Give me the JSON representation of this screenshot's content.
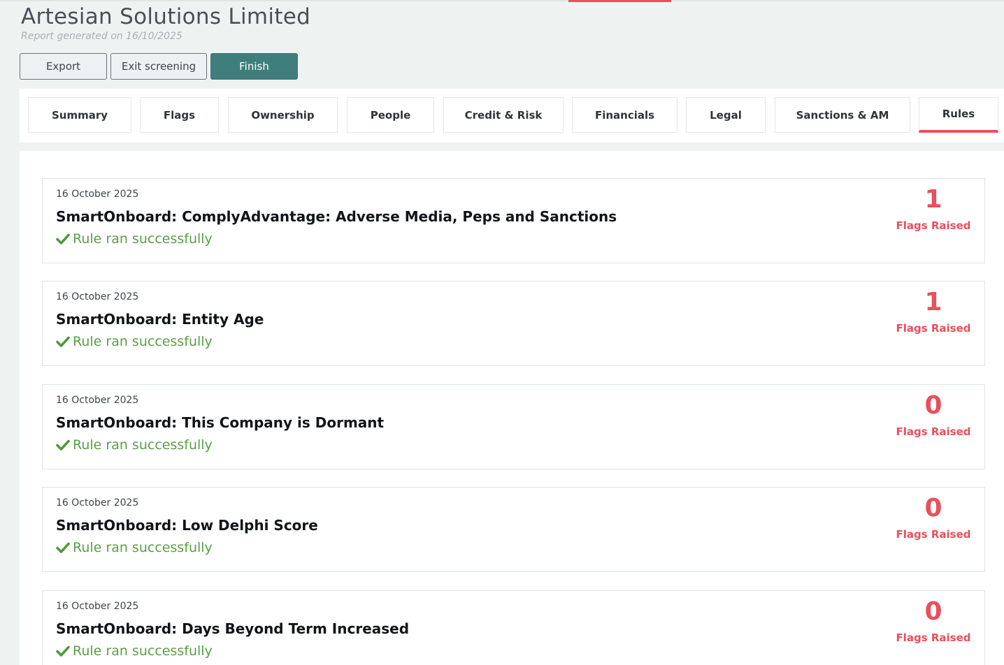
{
  "header": {
    "company_name": "Artesian Solutions Limited",
    "report_generated": "Report generated on 16/10/2025"
  },
  "actions": {
    "export_label": "Export",
    "exit_label": "Exit screening",
    "finish_label": "Finish"
  },
  "tabs": [
    {
      "label": "Summary",
      "active": false
    },
    {
      "label": "Flags",
      "active": false
    },
    {
      "label": "Ownership",
      "active": false
    },
    {
      "label": "People",
      "active": false
    },
    {
      "label": "Credit & Risk",
      "active": false
    },
    {
      "label": "Financials",
      "active": false
    },
    {
      "label": "Legal",
      "active": false
    },
    {
      "label": "Sanctions & AM",
      "active": false
    },
    {
      "label": "Rules",
      "active": true
    }
  ],
  "rules": [
    {
      "date": "16 October 2025",
      "title": "SmartOnboard: ComplyAdvantage: Adverse Media, Peps and Sanctions",
      "status": "Rule ran successfully",
      "flags_count": "1",
      "flags_label": "Flags Raised"
    },
    {
      "date": "16 October 2025",
      "title": "SmartOnboard: Entity Age",
      "status": "Rule ran successfully",
      "flags_count": "1",
      "flags_label": "Flags Raised"
    },
    {
      "date": "16 October 2025",
      "title": "SmartOnboard: This Company is Dormant",
      "status": "Rule ran successfully",
      "flags_count": "0",
      "flags_label": "Flags Raised"
    },
    {
      "date": "16 October 2025",
      "title": "SmartOnboard: Low Delphi Score",
      "status": "Rule ran successfully",
      "flags_count": "0",
      "flags_label": "Flags Raised"
    },
    {
      "date": "16 October 2025",
      "title": "SmartOnboard: Days Beyond Term Increased",
      "status": "Rule ran successfully",
      "flags_count": "0",
      "flags_label": "Flags Raised"
    }
  ],
  "colors": {
    "accent": "#e8505b",
    "primary_button": "#3f7e7c",
    "success": "#5a9e47"
  },
  "icons": {
    "status_icon": "check-icon"
  }
}
